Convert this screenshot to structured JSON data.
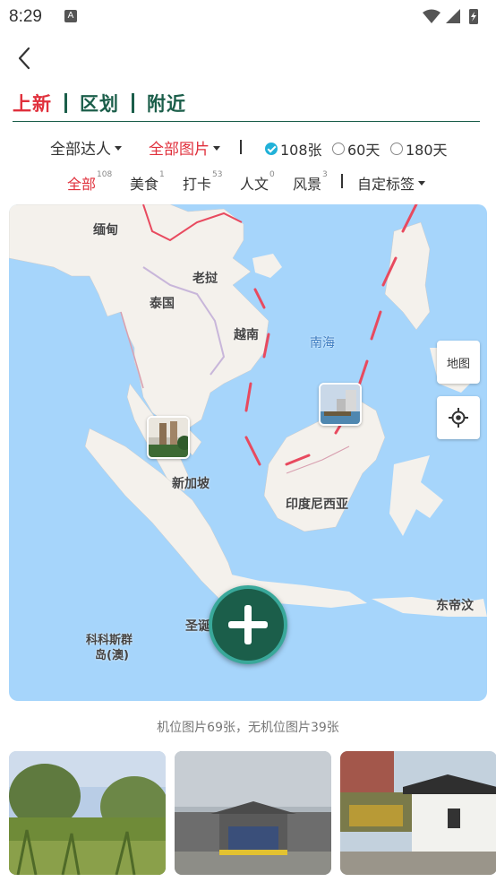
{
  "status_bar": {
    "time": "8:29",
    "notification_icon": "A",
    "icons": [
      "wifi-icon",
      "signal-icon",
      "battery-charging-icon"
    ]
  },
  "header": {
    "back_icon": "chevron-left-icon",
    "tabs": [
      {
        "label": "上新",
        "active": true
      },
      {
        "label": "区划",
        "active": false
      },
      {
        "label": "附近",
        "active": false
      }
    ]
  },
  "filters": {
    "expert": "全部达人",
    "image_type": "全部图片",
    "ranges": [
      {
        "label": "108张",
        "selected": true
      },
      {
        "label": "60天",
        "selected": false
      },
      {
        "label": "180天",
        "selected": false
      }
    ],
    "tags": [
      {
        "label": "全部",
        "count": "108",
        "active": true
      },
      {
        "label": "美食",
        "count": "1",
        "active": false
      },
      {
        "label": "打卡",
        "count": "53",
        "active": false
      },
      {
        "label": "人文",
        "count": "0",
        "active": false
      },
      {
        "label": "风景",
        "count": "3",
        "active": false
      }
    ],
    "custom_tag": "自定标签"
  },
  "map": {
    "labels": {
      "myanmar": "缅甸",
      "laos": "老挝",
      "thailand": "泰国",
      "vietnam": "越南",
      "south_china_sea": "南海",
      "singapore": "新加坡",
      "indonesia": "印度尼西亚",
      "east_timor": "东帝汶",
      "christmas_island_partial": "圣诞",
      "cocos_islands": "科科斯群",
      "cocos_islands_2": "岛(澳)"
    },
    "layer_button": "地图",
    "locate_icon": "crosshair-icon",
    "add_icon": "plus-icon",
    "colors": {
      "water": "#a6d5fb",
      "land": "#f4f1ec",
      "border": "#e84a5f",
      "accent": "#1b5e4a"
    }
  },
  "summary": "机位图片69张，无机位图片39张",
  "photos": [
    "photo-grass-trees",
    "photo-gate-building",
    "photo-white-wall-building"
  ]
}
